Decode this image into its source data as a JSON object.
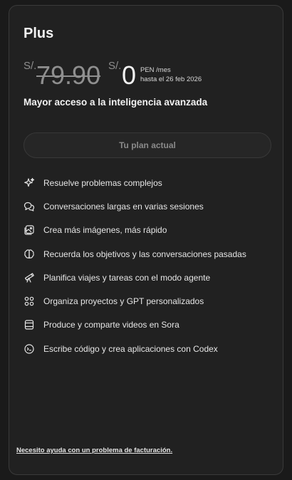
{
  "plan": {
    "name": "Plus",
    "old_currency": "S/.",
    "old_price": "79.90",
    "new_currency": "S/.",
    "new_price": "0",
    "period": "PEN /mes",
    "until": "hasta el 26 feb 2026",
    "tagline": "Mayor acceso a la inteligencia avanzada",
    "button_label": "Tu plan actual"
  },
  "features": [
    {
      "icon": "sparkle-icon",
      "label": "Resuelve problemas complejos"
    },
    {
      "icon": "chat-bubbles-icon",
      "label": "Conversaciones largas en varias sesiones"
    },
    {
      "icon": "image-icon",
      "label": "Crea más imágenes, más rápido"
    },
    {
      "icon": "brain-icon",
      "label": "Recuerda los objetivos y las conversaciones pasadas"
    },
    {
      "icon": "telescope-icon",
      "label": "Planifica viajes y tareas con el modo agente"
    },
    {
      "icon": "grid-icon",
      "label": "Organiza proyectos y GPT personalizados"
    },
    {
      "icon": "video-icon",
      "label": "Produce y comparte videos en Sora"
    },
    {
      "icon": "code-icon",
      "label": "Escribe código y crea aplicaciones con Codex"
    }
  ],
  "help_link": "Necesito ayuda con un problema de facturación."
}
